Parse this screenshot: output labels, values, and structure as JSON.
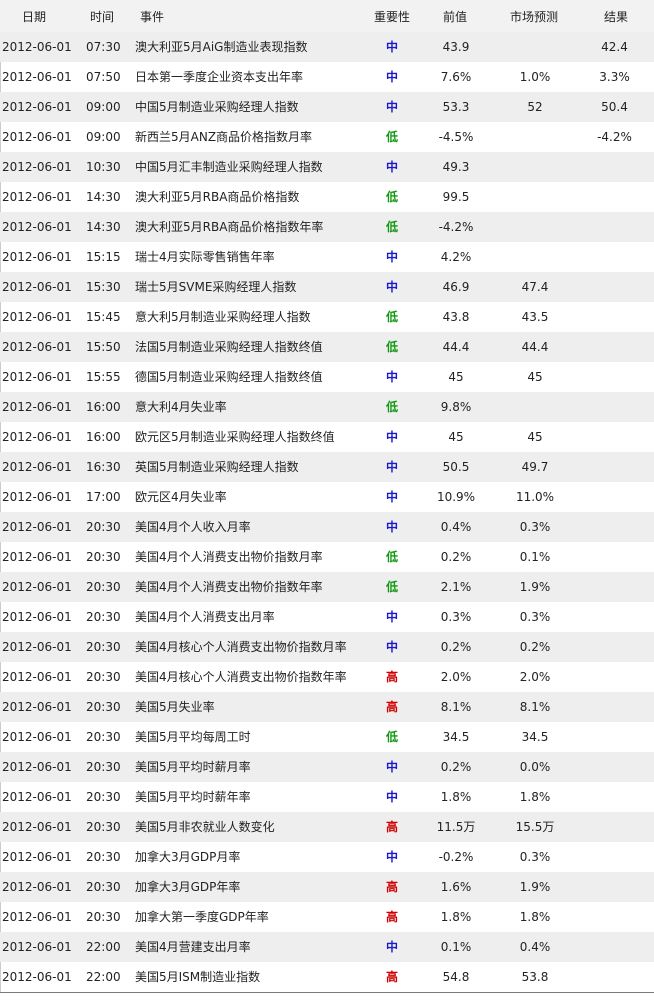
{
  "header": {
    "date": "日期",
    "time": "时间",
    "event": "事件",
    "importance": "重要性",
    "previous": "前值",
    "forecast": "市场预测",
    "actual": "结果"
  },
  "colors": {
    "high": "#d00000",
    "medium": "#1a1ac8",
    "low": "#119911"
  },
  "rows": [
    {
      "date": "2012-06-01",
      "time": "07:30",
      "event": "澳大利亚5月AiG制造业表现指数",
      "importance": "中",
      "level": "mid",
      "previous": "43.9",
      "forecast": "",
      "actual": "42.4"
    },
    {
      "date": "2012-06-01",
      "time": "07:50",
      "event": "日本第一季度企业资本支出年率",
      "importance": "中",
      "level": "mid",
      "previous": "7.6%",
      "forecast": "1.0%",
      "actual": "3.3%"
    },
    {
      "date": "2012-06-01",
      "time": "09:00",
      "event": "中国5月制造业采购经理人指数",
      "importance": "中",
      "level": "mid",
      "previous": "53.3",
      "forecast": "52",
      "actual": "50.4"
    },
    {
      "date": "2012-06-01",
      "time": "09:00",
      "event": "新西兰5月ANZ商品价格指数月率",
      "importance": "低",
      "level": "low",
      "previous": "-4.5%",
      "forecast": "",
      "actual": "-4.2%"
    },
    {
      "date": "2012-06-01",
      "time": "10:30",
      "event": "中国5月汇丰制造业采购经理人指数",
      "importance": "中",
      "level": "mid",
      "previous": "49.3",
      "forecast": "",
      "actual": ""
    },
    {
      "date": "2012-06-01",
      "time": "14:30",
      "event": "澳大利亚5月RBA商品价格指数",
      "importance": "低",
      "level": "low",
      "previous": "99.5",
      "forecast": "",
      "actual": ""
    },
    {
      "date": "2012-06-01",
      "time": "14:30",
      "event": "澳大利亚5月RBA商品价格指数年率",
      "importance": "低",
      "level": "low",
      "previous": "-4.2%",
      "forecast": "",
      "actual": ""
    },
    {
      "date": "2012-06-01",
      "time": "15:15",
      "event": "瑞士4月实际零售销售年率",
      "importance": "中",
      "level": "mid",
      "previous": "4.2%",
      "forecast": "",
      "actual": ""
    },
    {
      "date": "2012-06-01",
      "time": "15:30",
      "event": "瑞士5月SVME采购经理人指数",
      "importance": "中",
      "level": "mid",
      "previous": "46.9",
      "forecast": "47.4",
      "actual": ""
    },
    {
      "date": "2012-06-01",
      "time": "15:45",
      "event": "意大利5月制造业采购经理人指数",
      "importance": "低",
      "level": "low",
      "previous": "43.8",
      "forecast": "43.5",
      "actual": ""
    },
    {
      "date": "2012-06-01",
      "time": "15:50",
      "event": "法国5月制造业采购经理人指数终值",
      "importance": "低",
      "level": "low",
      "previous": "44.4",
      "forecast": "44.4",
      "actual": ""
    },
    {
      "date": "2012-06-01",
      "time": "15:55",
      "event": "德国5月制造业采购经理人指数终值",
      "importance": "中",
      "level": "mid",
      "previous": "45",
      "forecast": "45",
      "actual": ""
    },
    {
      "date": "2012-06-01",
      "time": "16:00",
      "event": "意大利4月失业率",
      "importance": "低",
      "level": "low",
      "previous": "9.8%",
      "forecast": "",
      "actual": ""
    },
    {
      "date": "2012-06-01",
      "time": "16:00",
      "event": "欧元区5月制造业采购经理人指数终值",
      "importance": "中",
      "level": "mid",
      "previous": "45",
      "forecast": "45",
      "actual": ""
    },
    {
      "date": "2012-06-01",
      "time": "16:30",
      "event": "英国5月制造业采购经理人指数",
      "importance": "中",
      "level": "mid",
      "previous": "50.5",
      "forecast": "49.7",
      "actual": ""
    },
    {
      "date": "2012-06-01",
      "time": "17:00",
      "event": "欧元区4月失业率",
      "importance": "中",
      "level": "mid",
      "previous": "10.9%",
      "forecast": "11.0%",
      "actual": ""
    },
    {
      "date": "2012-06-01",
      "time": "20:30",
      "event": "美国4月个人收入月率",
      "importance": "中",
      "level": "mid",
      "previous": "0.4%",
      "forecast": "0.3%",
      "actual": ""
    },
    {
      "date": "2012-06-01",
      "time": "20:30",
      "event": "美国4月个人消费支出物价指数月率",
      "importance": "低",
      "level": "low",
      "previous": "0.2%",
      "forecast": "0.1%",
      "actual": ""
    },
    {
      "date": "2012-06-01",
      "time": "20:30",
      "event": "美国4月个人消费支出物价指数年率",
      "importance": "低",
      "level": "low",
      "previous": "2.1%",
      "forecast": "1.9%",
      "actual": ""
    },
    {
      "date": "2012-06-01",
      "time": "20:30",
      "event": "美国4月个人消费支出月率",
      "importance": "中",
      "level": "mid",
      "previous": "0.3%",
      "forecast": "0.3%",
      "actual": ""
    },
    {
      "date": "2012-06-01",
      "time": "20:30",
      "event": "美国4月核心个人消费支出物价指数月率",
      "importance": "中",
      "level": "mid",
      "previous": "0.2%",
      "forecast": "0.2%",
      "actual": ""
    },
    {
      "date": "2012-06-01",
      "time": "20:30",
      "event": "美国4月核心个人消费支出物价指数年率",
      "importance": "高",
      "level": "high",
      "previous": "2.0%",
      "forecast": "2.0%",
      "actual": ""
    },
    {
      "date": "2012-06-01",
      "time": "20:30",
      "event": "美国5月失业率",
      "importance": "高",
      "level": "high",
      "previous": "8.1%",
      "forecast": "8.1%",
      "actual": ""
    },
    {
      "date": "2012-06-01",
      "time": "20:30",
      "event": "美国5月平均每周工时",
      "importance": "低",
      "level": "low",
      "previous": "34.5",
      "forecast": "34.5",
      "actual": ""
    },
    {
      "date": "2012-06-01",
      "time": "20:30",
      "event": "美国5月平均时薪月率",
      "importance": "中",
      "level": "mid",
      "previous": "0.2%",
      "forecast": "0.0%",
      "actual": ""
    },
    {
      "date": "2012-06-01",
      "time": "20:30",
      "event": "美国5月平均时薪年率",
      "importance": "中",
      "level": "mid",
      "previous": "1.8%",
      "forecast": "1.8%",
      "actual": ""
    },
    {
      "date": "2012-06-01",
      "time": "20:30",
      "event": "美国5月非农就业人数变化",
      "importance": "高",
      "level": "high",
      "previous": "11.5万",
      "forecast": "15.5万",
      "actual": ""
    },
    {
      "date": "2012-06-01",
      "time": "20:30",
      "event": "加拿大3月GDP月率",
      "importance": "中",
      "level": "mid",
      "previous": "-0.2%",
      "forecast": "0.3%",
      "actual": ""
    },
    {
      "date": "2012-06-01",
      "time": "20:30",
      "event": "加拿大3月GDP年率",
      "importance": "高",
      "level": "high",
      "previous": "1.6%",
      "forecast": "1.9%",
      "actual": ""
    },
    {
      "date": "2012-06-01",
      "time": "20:30",
      "event": "加拿大第一季度GDP年率",
      "importance": "高",
      "level": "high",
      "previous": "1.8%",
      "forecast": "1.8%",
      "actual": ""
    },
    {
      "date": "2012-06-01",
      "time": "22:00",
      "event": "美国4月营建支出月率",
      "importance": "中",
      "level": "mid",
      "previous": "0.1%",
      "forecast": "0.4%",
      "actual": ""
    },
    {
      "date": "2012-06-01",
      "time": "22:00",
      "event": "美国5月ISM制造业指数",
      "importance": "高",
      "level": "high",
      "previous": "54.8",
      "forecast": "53.8",
      "actual": ""
    }
  ]
}
